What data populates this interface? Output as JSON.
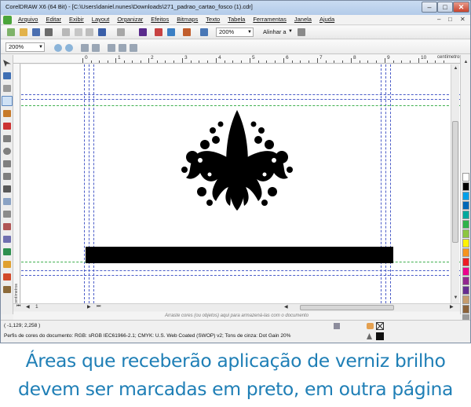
{
  "window": {
    "title": "CorelDRAW X6 (64 Bit) - [C:\\Users\\daniel.nunes\\Downloads\\271_padrao_cartao_fosco (1).cdr]",
    "minimize": "–",
    "maximize": "□",
    "close": "✕"
  },
  "menu": {
    "items": [
      "Arquivo",
      "Editar",
      "Exibir",
      "Layout",
      "Organizar",
      "Efeitos",
      "Bitmaps",
      "Texto",
      "Tabela",
      "Ferramentas",
      "Janela",
      "Ajuda"
    ],
    "mdi_min": "–",
    "mdi_max": "□",
    "mdi_close": "✕"
  },
  "toolbar": {
    "zoom_level": "200%",
    "snap_label": "Alinhar a"
  },
  "propbar": {
    "zoom_level": "200%"
  },
  "ruler": {
    "ticks": [
      "0",
      "1",
      "2",
      "3",
      "4",
      "5",
      "6",
      "7",
      "8",
      "9",
      "10"
    ],
    "unit": "centímetros",
    "left_unit": "centímetros"
  },
  "page_nav": {
    "page_label": "1"
  },
  "canvas": {
    "color_hint": "Arraste cores (ou objetos) aqui para armazená-las com o documento"
  },
  "status": {
    "coordinates": "( -1,129; 2,258 )",
    "profile": "Perfis de cores do documento: RGB: sRGB IEC61966-2.1; CMYK: U.S. Web Coated (SWOP) v2; Tons de cinza: Dot Gain 20%"
  },
  "caption": {
    "line1": "Áreas que receberão aplicação de verniz brilho",
    "line2": "devem ser marcadas em preto, em outra página"
  },
  "palette": {
    "colors": [
      "#ffffff",
      "#000000",
      "#00a0e9",
      "#0068b7",
      "#00a99d",
      "#2fb34a",
      "#8cc63f",
      "#fff200",
      "#f7941d",
      "#ed1c24",
      "#ec008c",
      "#92278f",
      "#662d91",
      "#c69c6d",
      "#8c6239",
      "#999999",
      "#cccccc"
    ]
  },
  "colors": {
    "caption": "#1f7fb6",
    "guides": "#4a5cc8",
    "bleed_guides": "#3fb04f"
  }
}
